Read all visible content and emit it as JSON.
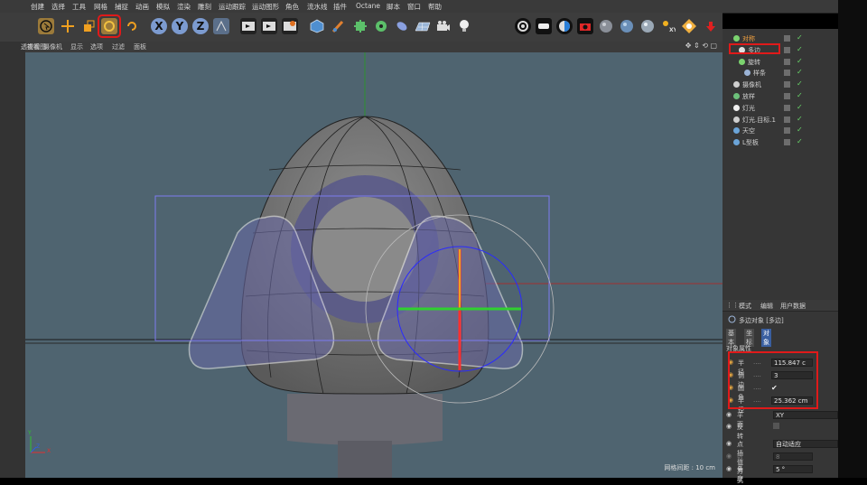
{
  "menu": [
    "创建",
    "选择",
    "工具",
    "网格",
    "捕捉",
    "动画",
    "模拟",
    "渲染",
    "雕刻",
    "运动跟踪",
    "运动图形",
    "角色",
    "流水线",
    "插件",
    "Octane",
    "脚本",
    "窗口",
    "帮助"
  ],
  "toolbar": {
    "axis_x": "X",
    "axis_y": "Y",
    "axis_z": "Z"
  },
  "viewport_menu": [
    "查看",
    "摄像机",
    "显示",
    "选项",
    "过滤",
    "面板"
  ],
  "viewport_corner": "透视视图",
  "viewport_status": "网格间距 : 10 cm",
  "axis_labels": {
    "y": "Y",
    "x": "X",
    "z": "Z"
  },
  "objects": [
    {
      "name": "对称",
      "icon_color": "#7bd36f"
    },
    {
      "name": "多边",
      "icon_color": "#e0e0e0"
    },
    {
      "name": "旋转",
      "icon_color": "#7bd36f"
    },
    {
      "name": "样条",
      "icon_color": "#9bb3d6"
    },
    {
      "name": "摄像机",
      "icon_color": "#cfcfcf"
    },
    {
      "name": "放样",
      "icon_color": "#6cc07a"
    },
    {
      "name": "灯光",
      "icon_color": "#f0f0f0"
    },
    {
      "name": "灯光.目标.1",
      "icon_color": "#cfcfcf"
    },
    {
      "name": "天空",
      "icon_color": "#6ba4d8"
    },
    {
      "name": "L型板",
      "icon_color": "#6ba4d8"
    }
  ],
  "attributes": {
    "tabs": [
      "模式",
      "编辑",
      "用户数据"
    ],
    "object_title": "多边对象 [多边]",
    "subtabs": [
      "基本",
      "坐标",
      "对象"
    ],
    "section": "对象属性",
    "props": [
      {
        "label": "半径",
        "value": "115.847 c"
      },
      {
        "label": "侧边",
        "value": "3"
      },
      {
        "label": "圆角",
        "value": "✔"
      },
      {
        "label": "半径",
        "value": "25.362 cm"
      }
    ],
    "plane_label": "平面",
    "plane_value": "XY",
    "reverse_label": "反转",
    "interp_label": "点插值方式",
    "interp_value": "自动适应",
    "count_label": "数量",
    "count_value": "8",
    "angle_label": "角度",
    "angle_value": "5 °"
  },
  "colors": {
    "highlight_red": "#e01a1a",
    "viewport_bg": "#4f6470"
  }
}
